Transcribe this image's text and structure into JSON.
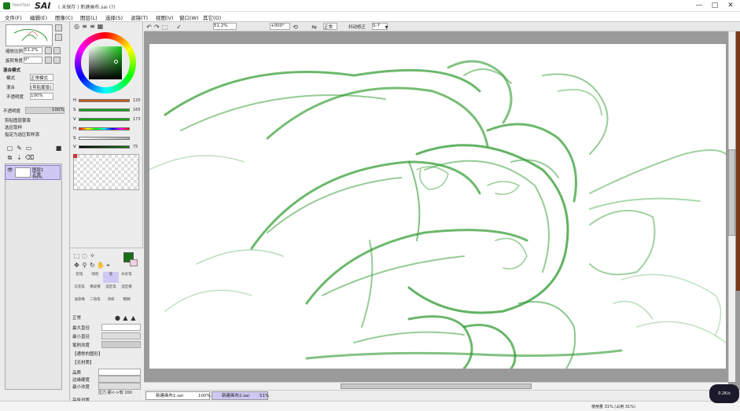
{
  "titlebar": {
    "app_sub": "PaintTool",
    "app_name": "SAI",
    "doc_title": "( 未保存 ) 新建画布.sai (?)",
    "minimize": "—",
    "maximize": "□",
    "close": "✕"
  },
  "menu": [
    "文件(F)",
    "编辑(E)",
    "图像(C)",
    "图层(L)",
    "选择(S)",
    "滤镜(T)",
    "视图(V)",
    "窗口(W)",
    "其它(O)"
  ],
  "navigator": {
    "zoom_label": "缩放比例",
    "zoom_value": "51.2%",
    "angle_label": "旋转角度",
    "angle_value": "0°"
  },
  "layer_props": {
    "section_title": "混合模式",
    "rows": [
      {
        "label": "模式",
        "value": "正常模式"
      },
      {
        "label": "混合",
        "value": "[剪贴蒙版]"
      },
      {
        "label": "不透明度",
        "value": "100%"
      }
    ],
    "opacity_label": "不透明度",
    "opacity_value": "100%",
    "checks": [
      "剪贴图层蒙版",
      "选区取样",
      "指定为选区取样源"
    ]
  },
  "layers": [
    {
      "name": "图层1",
      "mode": "正常",
      "opacity": "100%"
    }
  ],
  "color_sliders": [
    {
      "label": "H",
      "value": "120",
      "color": "#c85a1a"
    },
    {
      "label": "S",
      "value": "165",
      "color": "#15a015"
    },
    {
      "label": "V",
      "value": "173",
      "color": "#15a015"
    },
    {
      "label": "H",
      "value": "",
      "color": "#ff0000"
    },
    {
      "label": "S",
      "value": "",
      "color": "#aaaaaa"
    },
    {
      "label": "V",
      "value": "75",
      "color": "#157015"
    }
  ],
  "tools": {
    "brush_names": [
      "铅笔",
      "喷枪",
      "笔",
      "水彩笔",
      "马克笔",
      "橡皮擦",
      "选区笔",
      "选区擦",
      "油漆桶",
      "二值笔",
      "涂抹",
      "模糊"
    ],
    "max_size_label": "最大直径",
    "min_size_label": "最小直径",
    "density_label": "笔刷浓度",
    "shape_label": "【通常的圆形】",
    "texture_label": "【无材质】",
    "detail_labels": [
      "品质",
      "边缘硬度",
      "最小浓度"
    ],
    "pressure_label": "压力 硬<->软 100",
    "auto_check": "高级设置"
  },
  "canvas_toolbar": {
    "zoom": "51.2%",
    "angle": "+000°",
    "mode": "正常",
    "stabilizer": "S-7"
  },
  "doc_tabs": [
    {
      "name": "新建画布1.sai",
      "zoom": "100%"
    },
    {
      "name": "新建画布2.sai",
      "zoom": "51%"
    }
  ],
  "status": {
    "memory": "使用量 31% (占用 31%)",
    "selection": "",
    "badge": "0.2K/s"
  },
  "colors": {
    "sketch_green": "#2e9a2e",
    "foreground": "#157015",
    "background": "#f6cde0",
    "layer_selected": "#cfc8f2"
  }
}
